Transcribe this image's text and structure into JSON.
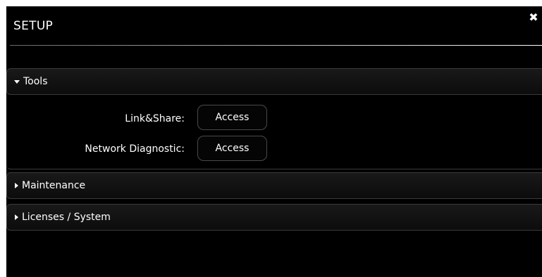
{
  "dialog": {
    "title": "SETUP",
    "close_icon": "close-icon",
    "close_glyph": "✖"
  },
  "sections": {
    "tools": {
      "label": "Tools",
      "state": "expanded",
      "rows": [
        {
          "label": "Link&Share:",
          "button": "Access"
        },
        {
          "label": "Network Diagnostic:",
          "button": "Access"
        }
      ]
    },
    "maintenance": {
      "label": "Maintenance",
      "state": "collapsed"
    },
    "licenses": {
      "label": "Licenses / System",
      "state": "collapsed"
    }
  },
  "colors": {
    "background": "#000000",
    "text": "#ffffff",
    "border": "#3a3a3a"
  }
}
